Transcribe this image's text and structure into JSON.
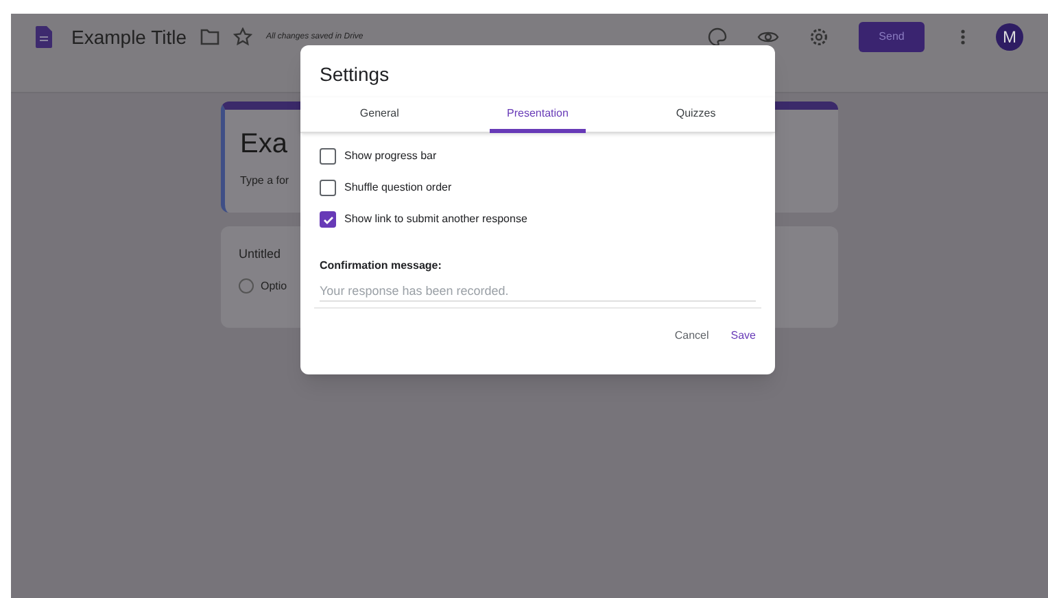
{
  "header": {
    "title": "Example Title",
    "save_status": "All changes saved in Drive",
    "send_button": "Send",
    "avatar": "M"
  },
  "form": {
    "title": "Exa",
    "description": "Type a for",
    "question": "Untitled",
    "option": "Optio",
    "option_selected": false
  },
  "dialog": {
    "title": "Settings",
    "tabs": [
      {
        "label": "General",
        "selected": false
      },
      {
        "label": "Presentation",
        "selected": true
      },
      {
        "label": "Quizzes",
        "selected": false
      }
    ],
    "options": [
      {
        "label": "Show progress bar",
        "checked": false
      },
      {
        "label": "Shuffle question order",
        "checked": false
      },
      {
        "label": "Show link to submit another response",
        "checked": true
      }
    ],
    "confirmation": {
      "label": "Confirmation message:",
      "placeholder": "Your response has been recorded."
    },
    "buttons": [
      {
        "label": "Cancel",
        "kind": "secondary"
      },
      {
        "label": "Save",
        "kind": "primary"
      }
    ]
  }
}
